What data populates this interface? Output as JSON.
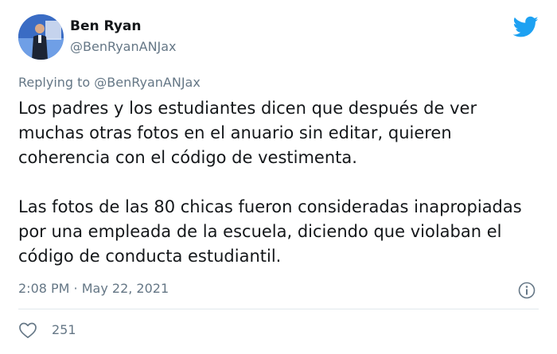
{
  "author": {
    "name": "Ben Ryan",
    "handle": "@BenRyanANJax"
  },
  "reply": {
    "prefix": "Replying to ",
    "handle": "@BenRyanANJax"
  },
  "body": {
    "paragraphs": [
      "Los padres y los estudiantes dicen que después de ver muchas otras fotos en el anuario sin editar, quieren coherencia con el código de vestimenta.",
      "Las fotos de las 80 chicas fueron consideradas inapropiadas por una empleada de la escuela, diciendo que violaban el código de conducta estudiantil."
    ]
  },
  "meta": {
    "time": "2:08 PM",
    "separator": " · ",
    "date": "May 22, 2021"
  },
  "engagement": {
    "likes": "251"
  },
  "icons": {
    "brand": "twitter-bird-icon",
    "info": "info-icon",
    "like": "heart-icon"
  },
  "colors": {
    "twitter_blue": "#1DA1F2",
    "text_primary": "#14171A",
    "text_secondary": "#657786",
    "divider": "#E1E8ED"
  }
}
